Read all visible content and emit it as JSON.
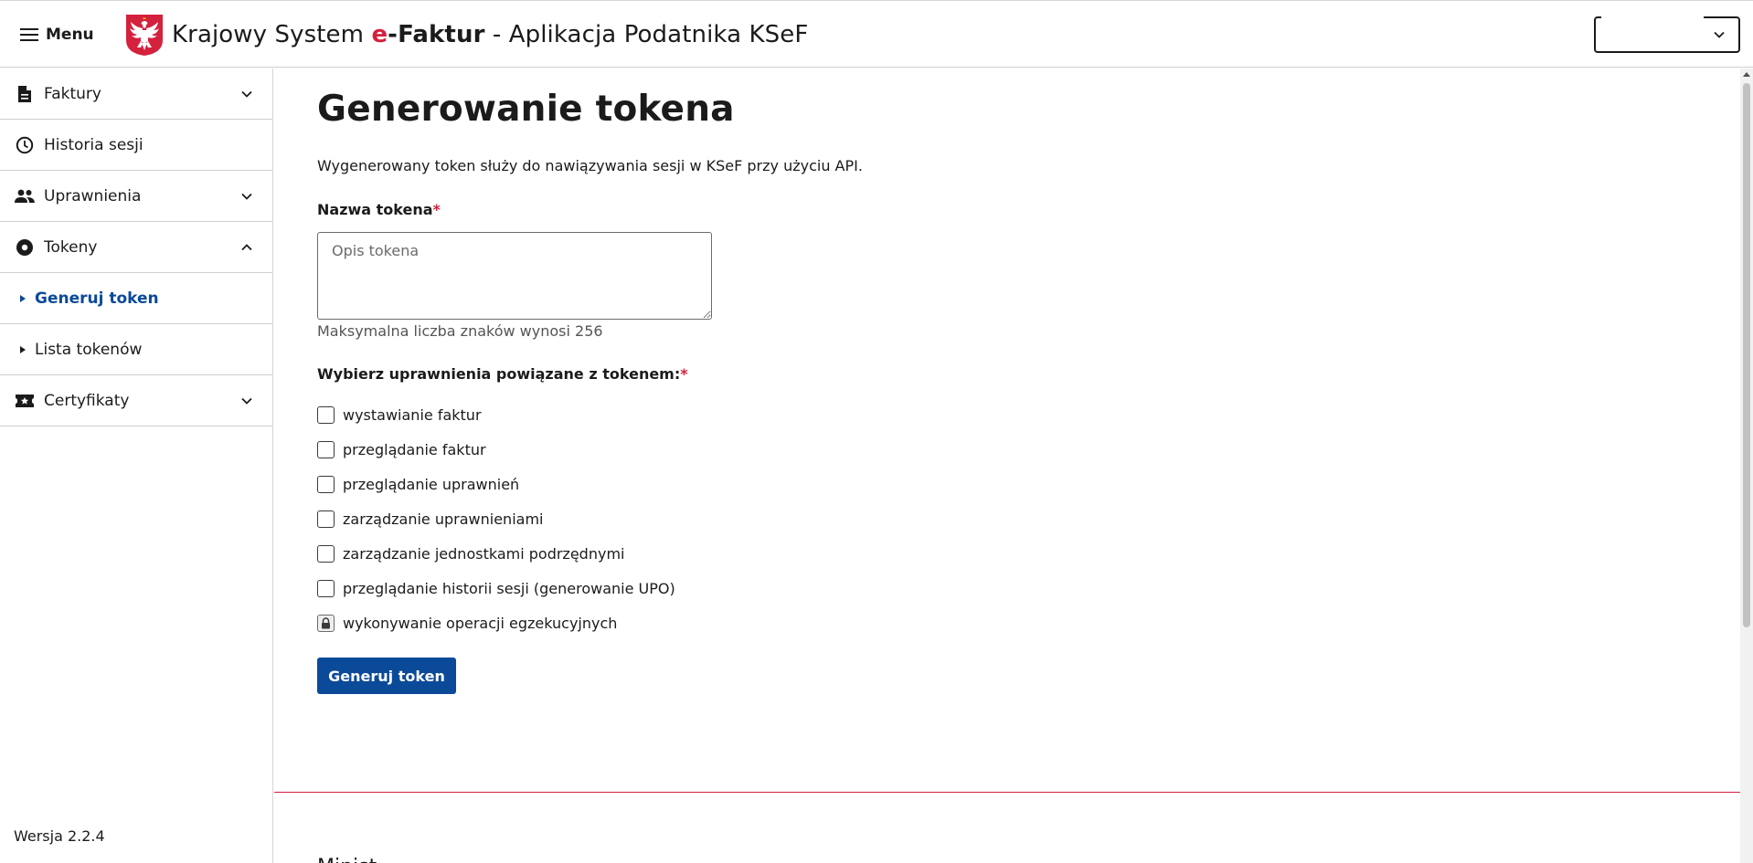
{
  "header": {
    "menu_label": "Menu",
    "title_prefix": "Krajowy System ",
    "title_e": "e",
    "title_faktur": "-Faktur",
    "title_suffix": " - Aplikacja Podatnika KSeF",
    "emblem": "polish-eagle-emblem",
    "lang_select_value": ""
  },
  "sidebar": {
    "items": [
      {
        "label": "Faktury",
        "icon": "document-icon",
        "expanded": false
      },
      {
        "label": "Historia sesji",
        "icon": "clock-icon"
      },
      {
        "label": "Uprawnienia",
        "icon": "people-icon",
        "expanded": false
      },
      {
        "label": "Tokeny",
        "icon": "token-icon",
        "expanded": true
      },
      {
        "label": "Certyfikaty",
        "icon": "certificate-icon",
        "expanded": false
      }
    ],
    "sub_items": [
      {
        "label": "Generuj token",
        "active": true
      },
      {
        "label": "Lista tokenów",
        "active": false
      }
    ],
    "version": "Wersja 2.2.4"
  },
  "main": {
    "title": "Generowanie tokena",
    "description": "Wygenerowany token służy do nawiązywania sesji w KSeF przy użyciu API.",
    "token_name_label": "Nazwa tokena",
    "required_mark": "*",
    "token_placeholder": "Opis tokena",
    "token_value": "",
    "hint": "Maksymalna liczba znaków wynosi 256",
    "permissions_label": "Wybierz uprawnienia powiązane z tokenem:",
    "permissions": [
      {
        "label": "wystawianie faktur",
        "checked": false,
        "locked": false
      },
      {
        "label": "przeglądanie faktur",
        "checked": false,
        "locked": false
      },
      {
        "label": "przeglądanie uprawnień",
        "checked": false,
        "locked": false
      },
      {
        "label": "zarządzanie uprawnieniami",
        "checked": false,
        "locked": false
      },
      {
        "label": "zarządzanie jednostkami podrzędnymi",
        "checked": false,
        "locked": false
      },
      {
        "label": "przeglądanie historii sesji (generowanie UPO)",
        "checked": false,
        "locked": false
      },
      {
        "label": "wykonywanie operacji egzekucyjnych",
        "checked": false,
        "locked": true
      }
    ],
    "generate_button": "Generuj token",
    "footer_partial": "Minist..."
  },
  "colors": {
    "brand_red": "#d4213d",
    "primary_blue": "#0b4a99",
    "text": "#1b1b1b"
  }
}
